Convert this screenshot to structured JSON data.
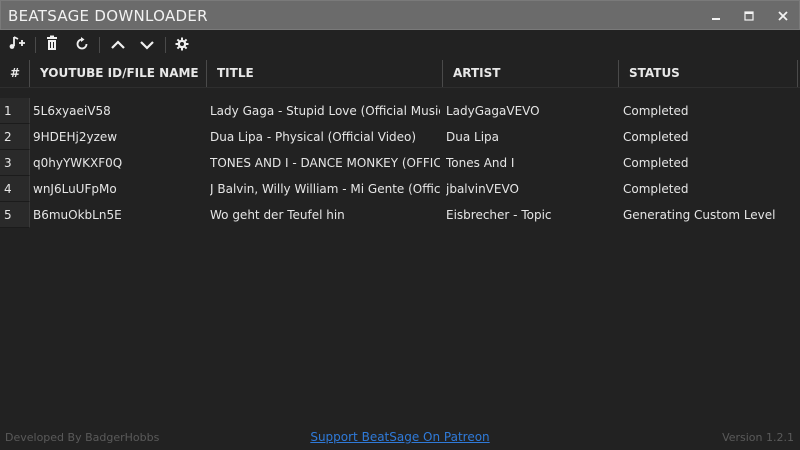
{
  "window": {
    "title": "BEATSAGE DOWNLOADER",
    "controls": [
      "minimize-icon",
      "maximize-icon",
      "close-icon"
    ]
  },
  "toolbar": {
    "buttons": [
      {
        "name": "add-song-icon"
      },
      {
        "name": "delete-icon"
      },
      {
        "name": "retry-icon"
      },
      {
        "name": "move-up-icon"
      },
      {
        "name": "move-down-icon"
      },
      {
        "name": "settings-icon"
      }
    ]
  },
  "table": {
    "headers": {
      "num": "#",
      "id": "YOUTUBE ID/FILE NAME",
      "title": "TITLE",
      "artist": "ARTIST",
      "status": "STATUS"
    },
    "rows": [
      {
        "num": "1",
        "id": "5L6xyaeiV58",
        "title": "Lady Gaga - Stupid Love (Official Music Video)",
        "artist": "LadyGagaVEVO",
        "status": "Completed"
      },
      {
        "num": "2",
        "id": "9HDEHj2yzew",
        "title": "Dua Lipa - Physical (Official Video)",
        "artist": "Dua Lipa",
        "status": "Completed"
      },
      {
        "num": "3",
        "id": "q0hyYWKXF0Q",
        "title": "TONES AND I - DANCE MONKEY (OFFICIAL VIDEO)",
        "artist": "Tones And I",
        "status": "Completed"
      },
      {
        "num": "4",
        "id": "wnJ6LuUFpMo",
        "title": "J Balvin, Willy William - Mi Gente (Official Video)",
        "artist": "jbalvinVEVO",
        "status": "Completed"
      },
      {
        "num": "5",
        "id": "B6muOkbLn5E",
        "title": "Wo geht der Teufel hin",
        "artist": "Eisbrecher - Topic",
        "status": "Generating Custom Level"
      }
    ]
  },
  "footer": {
    "credit": "Developed By BadgerHobbs",
    "link": "Support BeatSage On Patreon",
    "version": "Version 1.2.1"
  },
  "colors": {
    "background": "#222222",
    "titlebar": "#6b6b6b",
    "link": "#2f7ad9"
  }
}
